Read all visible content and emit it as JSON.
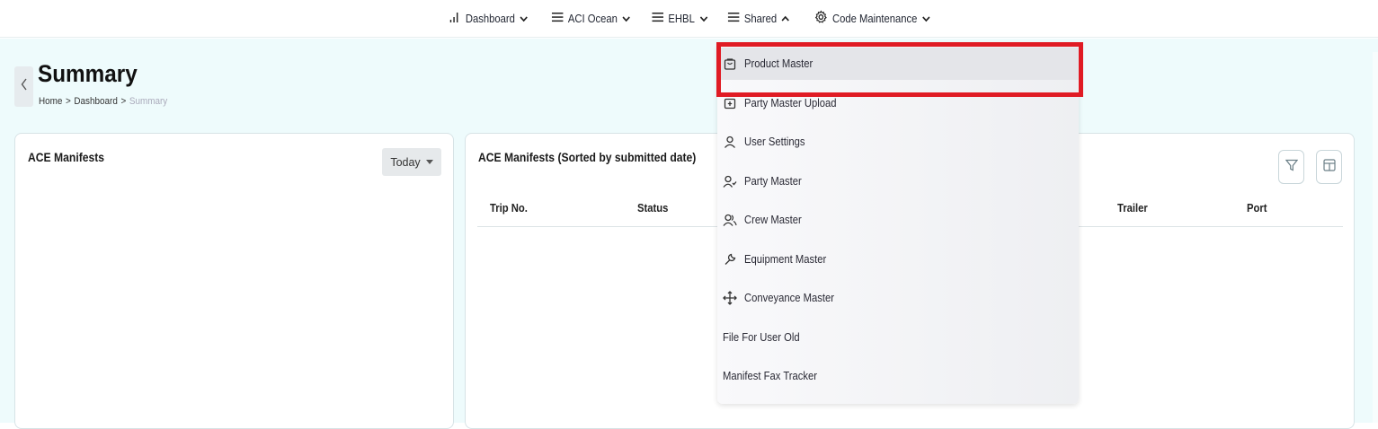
{
  "nav": {
    "items": [
      {
        "label": "Dashboard",
        "icon": "bar-chart-icon",
        "caret": "down"
      },
      {
        "label": "ACI Ocean",
        "icon": "menu-icon",
        "caret": "down"
      },
      {
        "label": "EHBL",
        "icon": "menu-icon",
        "caret": "down"
      },
      {
        "label": "Shared",
        "icon": "menu-icon",
        "caret": "up"
      },
      {
        "label": "Code Maintenance",
        "icon": "gear-icon",
        "caret": "down"
      }
    ]
  },
  "page": {
    "title": "Summary",
    "breadcrumb": [
      "Home",
      "Dashboard",
      "Summary"
    ],
    "breadcrumb_sep": ">"
  },
  "left_card": {
    "title": "ACE Manifests",
    "filter_label": "Today"
  },
  "right_card": {
    "title": "ACE Manifests (Sorted by submitted date)",
    "columns": [
      "Trip No.",
      "Status",
      "Trailer",
      "Port"
    ]
  },
  "dropdown": {
    "items": [
      {
        "label": "Product Master",
        "icon": "bag-icon",
        "active": true
      },
      {
        "label": "Party Master Upload",
        "icon": "upload-box-icon"
      },
      {
        "label": "User Settings",
        "icon": "user-icon"
      },
      {
        "label": "Party Master",
        "icon": "user-check-icon"
      },
      {
        "label": "Crew Master",
        "icon": "users-icon"
      },
      {
        "label": "Equipment Master",
        "icon": "wrench-icon"
      },
      {
        "label": "Conveyance Master",
        "icon": "move-arrows-icon"
      },
      {
        "label": "File For User Old",
        "icon": ""
      },
      {
        "label": "Manifest Fax Tracker",
        "icon": ""
      }
    ]
  },
  "colors": {
    "highlight": "#e01b24",
    "background": "#eefbfc",
    "card": "#ffffff"
  }
}
